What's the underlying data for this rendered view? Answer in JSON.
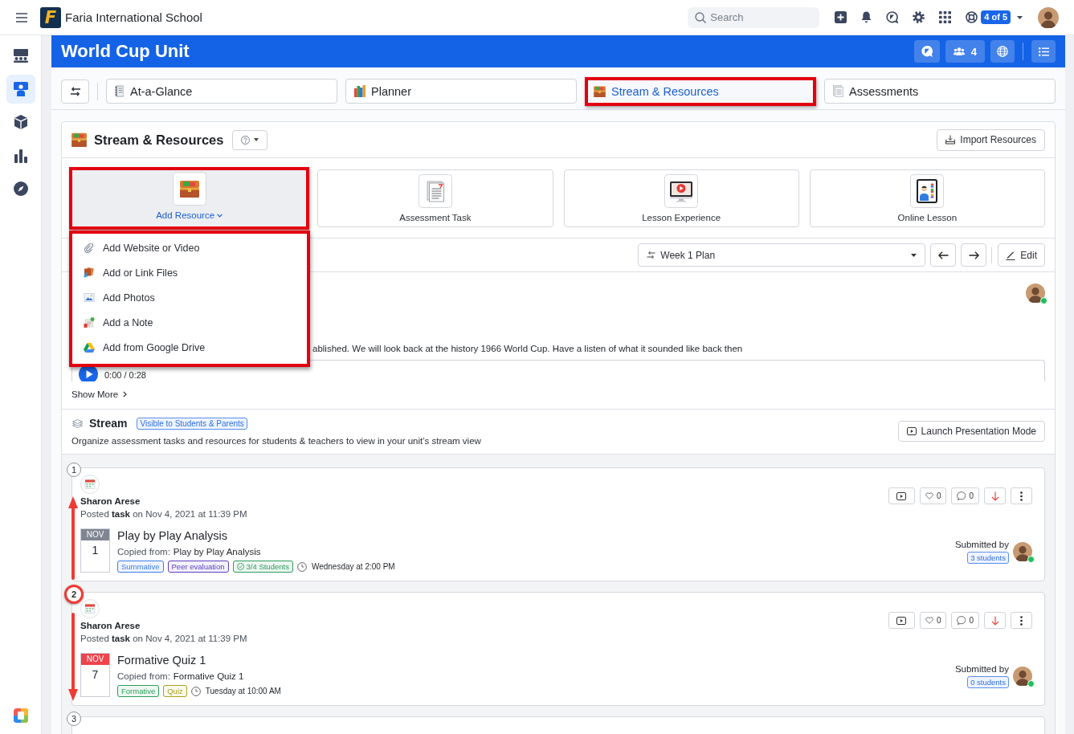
{
  "top_bar": {
    "logo_letter": "F",
    "school_name": "Faria International School",
    "search": {
      "placeholder": "Search"
    },
    "counter": "4 of 5"
  },
  "sidebar": {
    "items": [
      {
        "kind": "classes",
        "selected": false
      },
      {
        "kind": "planner",
        "selected": true
      },
      {
        "kind": "cube",
        "selected": false
      },
      {
        "kind": "chart",
        "selected": false
      },
      {
        "kind": "compass",
        "selected": false
      }
    ]
  },
  "unit_header": {
    "title": "World Cup Unit",
    "members": "4"
  },
  "tabs": [
    {
      "label": "At-a-Glance",
      "kind": "notebook",
      "selected": false,
      "annotated": false
    },
    {
      "label": "Planner",
      "kind": "books",
      "selected": false,
      "annotated": false
    },
    {
      "label": "Stream & Resources",
      "kind": "chest",
      "selected": true,
      "annotated": true
    },
    {
      "label": "Assessments",
      "kind": "papers",
      "selected": false,
      "annotated": false
    }
  ],
  "resources_panel": {
    "title": "Stream & Resources",
    "import_button": "Import Resources",
    "tiles": [
      {
        "label": "Add Resource",
        "kind": "chest",
        "expanded": true,
        "annotated": true,
        "menu": {
          "annotated": true,
          "items": [
            {
              "label": "Add Website or Video",
              "kind": "link"
            },
            {
              "label": "Add or Link Files",
              "kind": "files"
            },
            {
              "label": "Add Photos",
              "kind": "photo"
            },
            {
              "label": "Add a Note",
              "kind": "note"
            },
            {
              "label": "Add from Google Drive",
              "kind": "drive"
            }
          ]
        }
      },
      {
        "label": "Assessment Task",
        "kind": "test",
        "expanded": false,
        "annotated": false
      },
      {
        "label": "Lesson Experience",
        "kind": "lesson",
        "expanded": false,
        "annotated": false
      },
      {
        "label": "Online Lesson",
        "kind": "online",
        "expanded": false,
        "annotated": false
      }
    ],
    "plan_select": {
      "value": "Week 1 Plan"
    },
    "edit_button": "Edit",
    "post": {
      "author_online": true,
      "text": "ablished. We will look back at the history 1966 World Cup. Have a listen of what it sounded like back then",
      "audio_time": "0:00 / 0:28"
    },
    "show_more": "Show More"
  },
  "stream": {
    "title": "Stream",
    "visibility_badge": "Visible to Students & Parents",
    "description": "Organize assessment tasks and resources for students & teachers to view in your unit’s stream view",
    "launch_button": "Launch Presentation Mode",
    "items": [
      {
        "number": "1",
        "number_highlighted": false,
        "arrow_up": true,
        "arrow_down": false,
        "author": "Sharon Arese",
        "posted": "Posted **task** on Nov 4, 2021 at 11:39 PM",
        "month": "NOV",
        "day": "1",
        "color": "#7f8691",
        "title": "Play by Play Analysis",
        "copied_label": "Copied from:",
        "copied_from": "Play by Play Analysis",
        "tags": [
          {
            "label": "Summative",
            "kind": "plain",
            "color": "#3d7be6"
          },
          {
            "label": "Peer evaluation",
            "kind": "plain",
            "color": "#5b3fc0"
          },
          {
            "label": "3/4 Students",
            "kind": "check",
            "color": "#2a9d5c"
          }
        ],
        "due": "Wednesday at 2:00 PM",
        "likes": "0",
        "comments": "0",
        "submitted_label": "Submitted by",
        "submitted_count": "3 students",
        "submitter_online": true
      },
      {
        "number": "2",
        "number_highlighted": true,
        "arrow_up": false,
        "arrow_down": true,
        "author": "Sharon Arese",
        "posted": "Posted **task** on Nov 4, 2021 at 11:39 PM",
        "month": "NOV",
        "day": "7",
        "color": "#f0434b",
        "title": "Formative Quiz 1",
        "copied_label": "Copied from:",
        "copied_from": "Formative Quiz 1",
        "tags": [
          {
            "label": "Formative",
            "kind": "plain",
            "color": "#2a9d5c"
          },
          {
            "label": "Quiz",
            "kind": "plain",
            "color": "#a8a21a"
          }
        ],
        "due": "Tuesday at 10:00 AM",
        "likes": "0",
        "comments": "0",
        "submitted_label": "Submitted by",
        "submitted_count": "0 students",
        "submitter_online": true
      },
      {
        "number": "3",
        "number_highlighted": false,
        "arrow_up": false,
        "arrow_down": false
      }
    ]
  }
}
